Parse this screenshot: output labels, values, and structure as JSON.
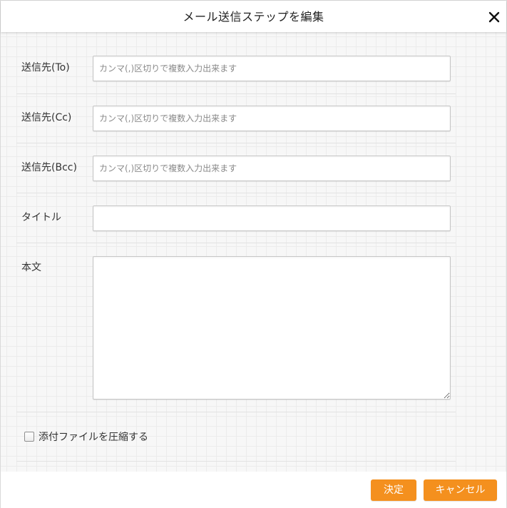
{
  "dialog": {
    "title": "メール送信ステップを編集",
    "close_icon": "close-icon"
  },
  "form": {
    "to": {
      "label": "送信先(To)",
      "value": "",
      "placeholder": "カンマ(,)区切りで複数入力出来ます"
    },
    "cc": {
      "label": "送信先(Cc)",
      "value": "",
      "placeholder": "カンマ(,)区切りで複数入力出来ます"
    },
    "bcc": {
      "label": "送信先(Bcc)",
      "value": "",
      "placeholder": "カンマ(,)区切りで複数入力出来ます"
    },
    "title": {
      "label": "タイトル",
      "value": ""
    },
    "body": {
      "label": "本文",
      "value": ""
    },
    "compress": {
      "label": "添付ファイルを圧縮する",
      "checked": false
    }
  },
  "footer": {
    "ok_label": "決定",
    "cancel_label": "キャンセル"
  },
  "colors": {
    "accent": "#f4901e",
    "background_grid": "#f7f7f7"
  }
}
